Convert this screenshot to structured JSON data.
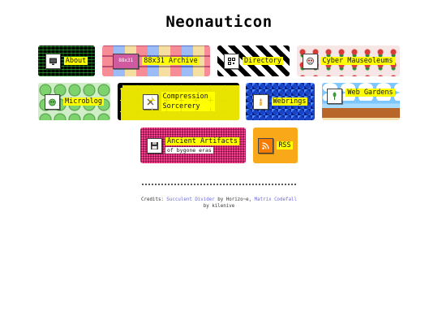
{
  "site": {
    "title": "Neonauticon"
  },
  "tiles": [
    {
      "label": "About",
      "icon": "monitor-icon"
    },
    {
      "label": "88x31 Archive",
      "icon": "button-badge-icon"
    },
    {
      "label": "Directory",
      "icon": "qr-code-icon"
    },
    {
      "label": "Cyber Mauseoleums",
      "icon": "skull-icon"
    },
    {
      "label": "Microblog",
      "icon": "blob-icon"
    },
    {
      "label": "Compression Sorcerery",
      "icon": "compress-tools-icon"
    },
    {
      "label": "Webrings",
      "icon": "candle-icon"
    },
    {
      "label": "Web Gardens",
      "icon": "plant-icon"
    },
    {
      "label": "Ancient Artifacts",
      "sub": "of bygone eras",
      "icon": "floppy-disk-icon"
    },
    {
      "label": "RSS",
      "icon": "rss-feed-icon"
    }
  ],
  "credits": {
    "prefix": "Credits: ",
    "link1": "Succulent Divider",
    "mid1": " by Horizo~e, ",
    "link2": "Matrix Codefall",
    "mid2": "by kilenive"
  }
}
